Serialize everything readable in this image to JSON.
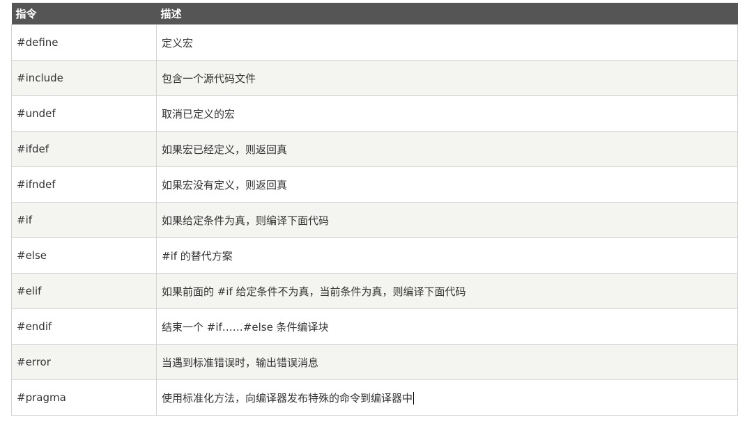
{
  "table": {
    "headers": {
      "directive": "指令",
      "description": "描述"
    },
    "rows": [
      {
        "directive": "#define",
        "description": "定义宏"
      },
      {
        "directive": "#include",
        "description": "包含一个源代码文件"
      },
      {
        "directive": "#undef",
        "description": "取消已定义的宏"
      },
      {
        "directive": "#ifdef",
        "description": "如果宏已经定义，则返回真"
      },
      {
        "directive": "#ifndef",
        "description": "如果宏没有定义，则返回真"
      },
      {
        "directive": "#if",
        "description": "如果给定条件为真，则编译下面代码"
      },
      {
        "directive": "#else",
        "description": "#if 的替代方案"
      },
      {
        "directive": "#elif",
        "description": "如果前面的 #if 给定条件不为真，当前条件为真，则编译下面代码"
      },
      {
        "directive": "#endif",
        "description": "结束一个 #if……#else 条件编译块"
      },
      {
        "directive": "#error",
        "description": "当遇到标准错误时，输出错误消息"
      },
      {
        "directive": "#pragma",
        "description": "使用标准化方法，向编译器发布特殊的命令到编译器中"
      }
    ]
  },
  "colors": {
    "header_bg": "#555555",
    "header_text": "#ffffff",
    "row_alt_bg": "#f4f4f0",
    "border": "#d4d4d4"
  }
}
